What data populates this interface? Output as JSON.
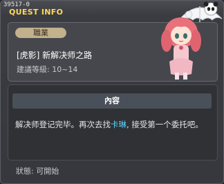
{
  "window": {
    "id_text": "39517-0",
    "title": "QUEST INFO"
  },
  "quest": {
    "badge": "職業",
    "name": "[虎影] 新解决师之路",
    "level": "建議等級: 10~14"
  },
  "content": {
    "header": "內容",
    "desc_before": "解决师登记完毕。再次去找",
    "npc_name": "卡琳",
    "desc_after": ", 接受第一个委托吧。"
  },
  "status": "狀態: 可開始",
  "colors": {
    "title": "#ffd85a",
    "npc_highlight": "#59d6ff",
    "badge_bg": "#c3b08c"
  }
}
